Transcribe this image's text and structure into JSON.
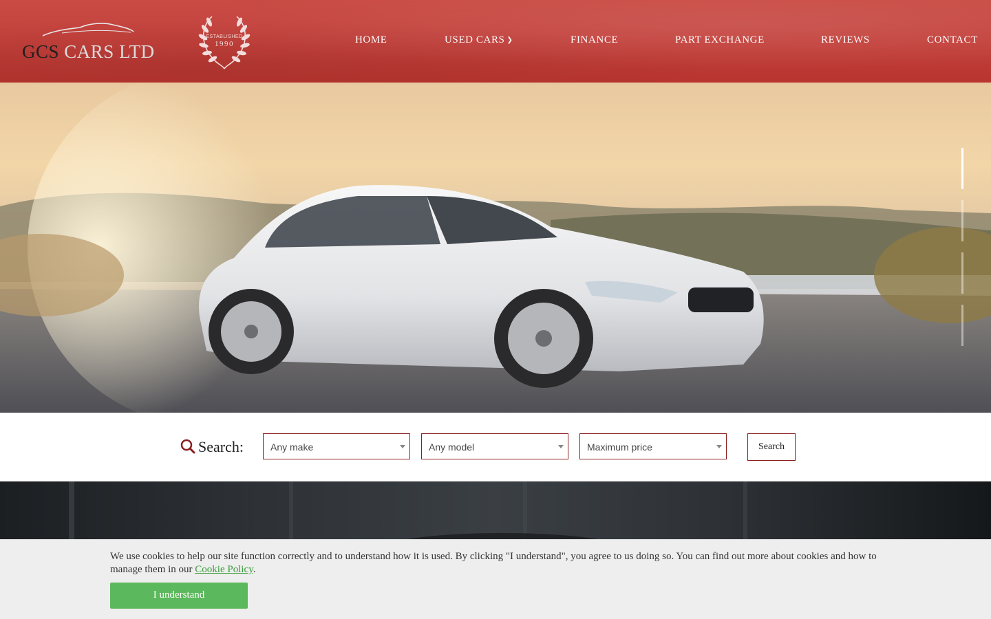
{
  "header": {
    "logo": {
      "part1": "GCS",
      "part2": "CARS LTD"
    },
    "badge": {
      "line1": "ESTABLISHED",
      "line2": "1990"
    },
    "nav": [
      {
        "label": "HOME"
      },
      {
        "label": "USED CARS",
        "icon": "chevron-down-icon"
      },
      {
        "label": "FINANCE"
      },
      {
        "label": "PART EXCHANGE"
      },
      {
        "label": "REVIEWS"
      },
      {
        "label": "CONTACT"
      }
    ]
  },
  "hero": {
    "slides_count": 4,
    "active_slide": 1
  },
  "search": {
    "label": "Search:",
    "icon": "search-icon",
    "make": {
      "value": "Any make"
    },
    "model": {
      "value": "Any model"
    },
    "price": {
      "value": "Maximum price"
    },
    "button_label": "Search"
  },
  "cookie": {
    "text_before": "We use cookies to help our site function correctly and to understand how it is used. By clicking \"I understand\", you agree to us doing so. You can find out more about cookies and how to manage them in our ",
    "link_text": "Cookie Policy",
    "text_after": ".",
    "button_label": "I understand"
  },
  "colors": {
    "header_red": "#c23f3a",
    "select_border": "#8a1f1f",
    "cookie_button": "#5cb85c",
    "cookie_link": "#3a9c3a"
  }
}
